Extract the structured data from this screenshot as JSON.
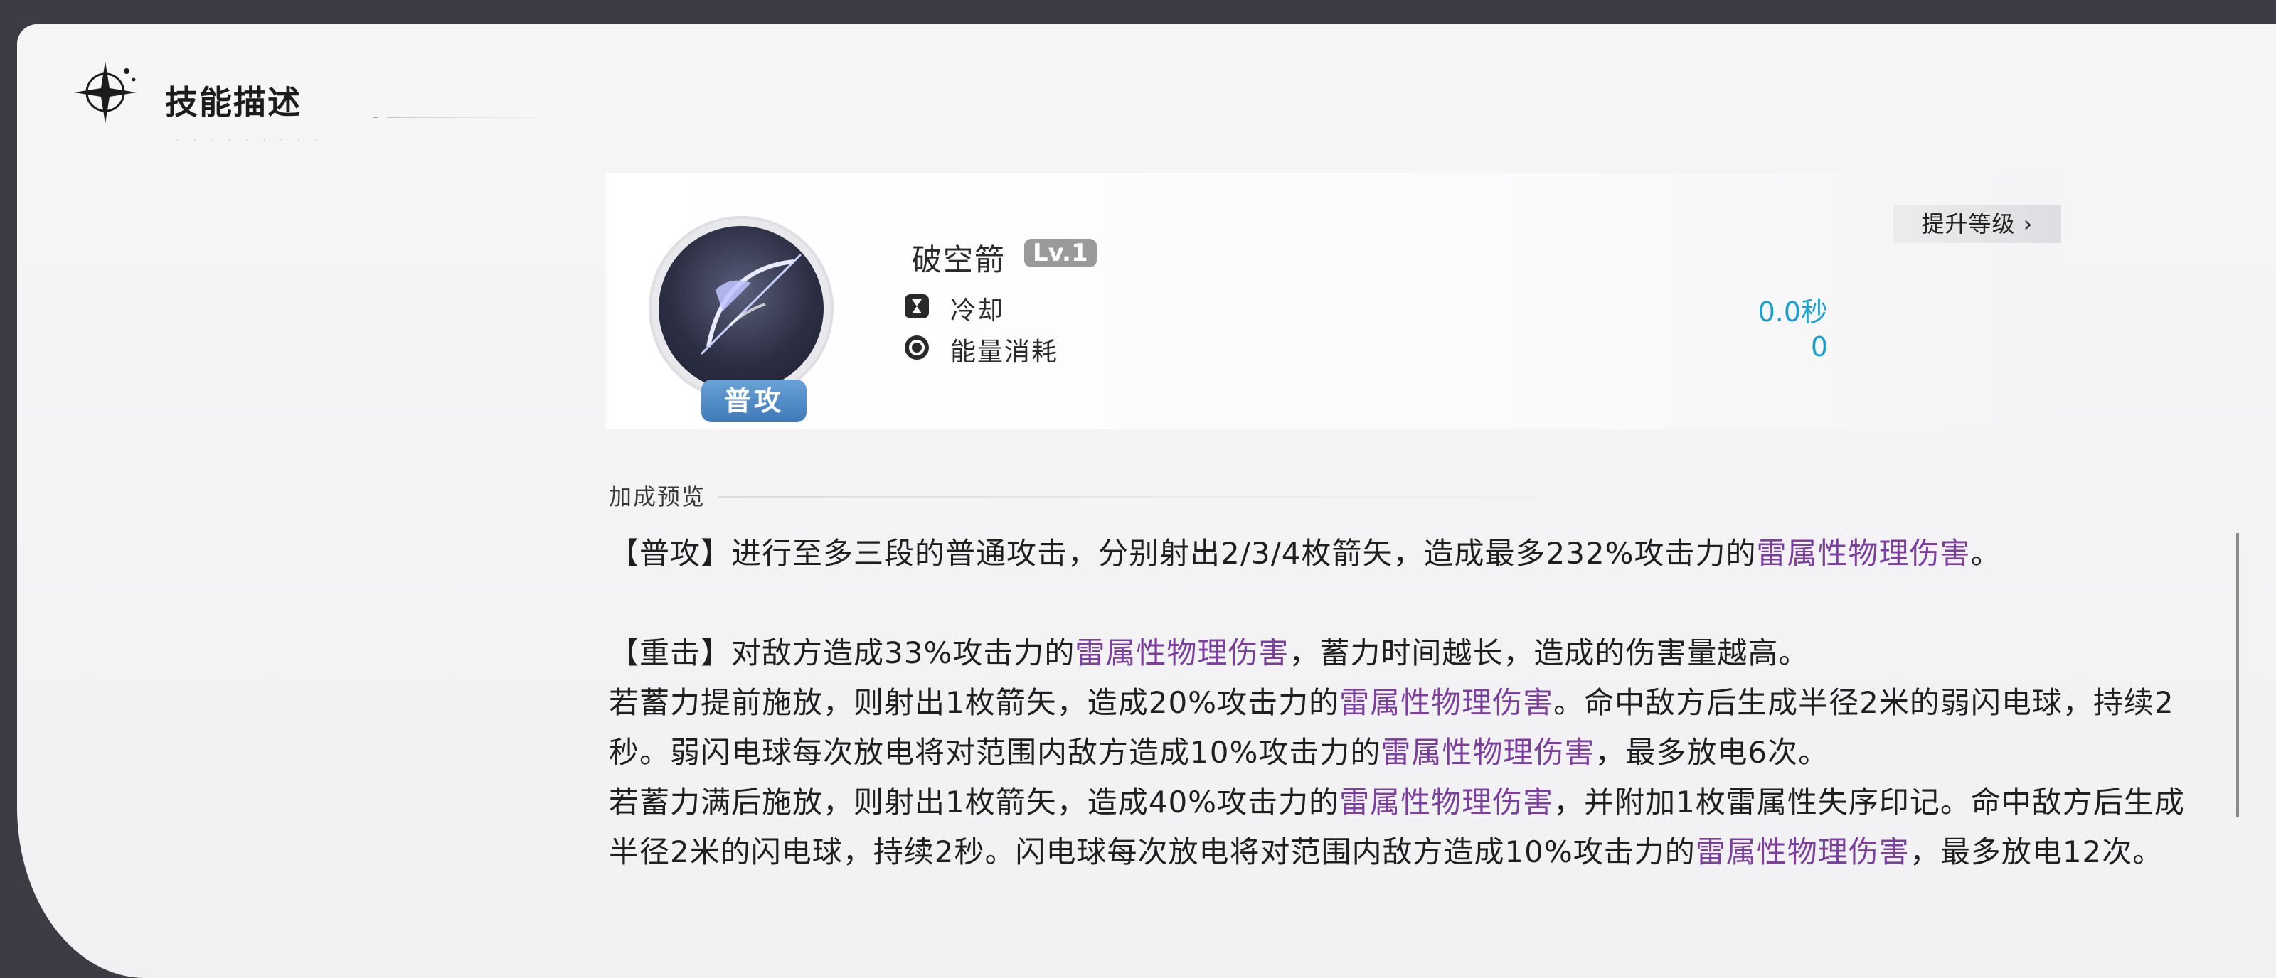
{
  "header": {
    "title": "技能描述",
    "subtitle_dots": "· · · · · · · · ·"
  },
  "skill": {
    "name": "破空箭",
    "level": "Lv.1",
    "badge": "普攻",
    "upgrade_label": "提升等级 ›",
    "stats": [
      {
        "label": "冷却",
        "value": "0.0秒",
        "icon": "hourglass-icon"
      },
      {
        "label": "能量消耗",
        "value": "0",
        "icon": "energy-icon"
      }
    ]
  },
  "section": {
    "label": "加成预览"
  },
  "description": {
    "p1": {
      "a": "【普攻】进行至多三段的普通攻击，分别射出2/3/4枚箭矢，造成最多232%攻击力的",
      "hl": "雷属性物理伤害",
      "b": "。"
    },
    "p2": {
      "a": "【重击】对敌方造成33%攻击力的",
      "hl": "雷属性物理伤害",
      "b": "，蓄力时间越长，造成的伤害量越高。"
    },
    "p3": {
      "a": "若蓄力提前施放，则射出1枚箭矢，造成20%攻击力的",
      "hl1": "雷属性物理伤害",
      "b": "。命中敌方后生成半径2米的弱闪电球，持续2秒。弱闪电球每次放电将对范围内敌方造成10%攻击力的",
      "hl2": "雷属性物理伤害",
      "c": "，最多放电6次。"
    },
    "p4": {
      "a": "若蓄力满后施放，则射出1枚箭矢，造成40%攻击力的",
      "hl1": "雷属性物理伤害",
      "b": "，并附加1枚雷属性失序印记。命中敌方后生成半径2米的闪电球，持续2秒。闪电球每次放电将对范围内敌方造成10%攻击力的",
      "hl2": "雷属性物理伤害",
      "c": "，最多放电12次。"
    }
  },
  "colors": {
    "highlight": "#7b3f9e",
    "value": "#1aa0cc",
    "badge": "#4a86c4"
  }
}
